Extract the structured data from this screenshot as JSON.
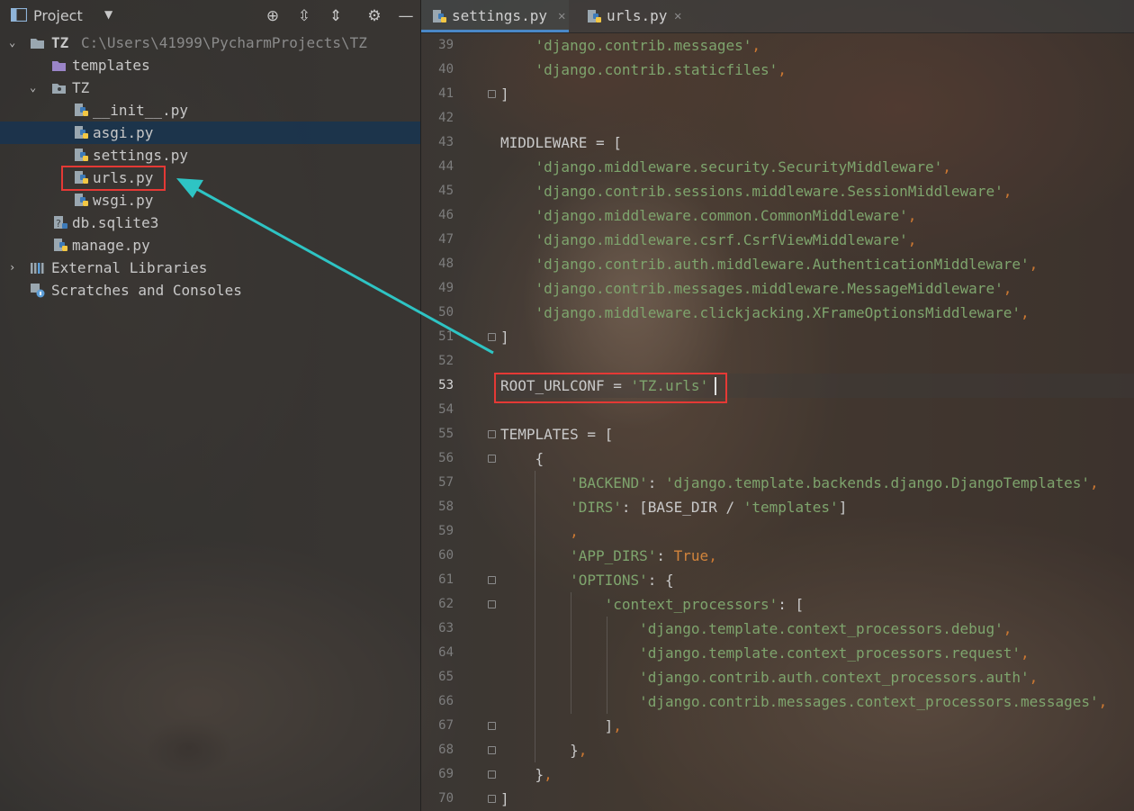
{
  "project_panel": {
    "title": "Project",
    "tree": [
      {
        "label": "TZ",
        "path": "C:\\Users\\41999\\PycharmProjects\\TZ"
      },
      {
        "label": "templates"
      },
      {
        "label": "TZ"
      },
      {
        "label": "__init__.py"
      },
      {
        "label": "asgi.py"
      },
      {
        "label": "settings.py"
      },
      {
        "label": "urls.py"
      },
      {
        "label": "wsgi.py"
      },
      {
        "label": "db.sqlite3"
      },
      {
        "label": "manage.py"
      },
      {
        "label": "External Libraries"
      },
      {
        "label": "Scratches and Consoles"
      }
    ]
  },
  "editor": {
    "tabs": [
      {
        "label": "settings.py",
        "active": true
      },
      {
        "label": "urls.py",
        "active": false
      }
    ],
    "line_numbers": [
      "39",
      "40",
      "41",
      "42",
      "43",
      "44",
      "45",
      "46",
      "47",
      "48",
      "49",
      "50",
      "51",
      "52",
      "53",
      "54",
      "55",
      "56",
      "57",
      "58",
      "59",
      "60",
      "61",
      "62",
      "63",
      "64",
      "65",
      "66",
      "67",
      "68",
      "69",
      "70"
    ],
    "lines": [
      [
        {
          "t": "    "
        },
        {
          "t": "'django.contrib.messages'",
          "c": "s"
        },
        {
          "t": ",",
          "c": "p"
        }
      ],
      [
        {
          "t": "    "
        },
        {
          "t": "'django.contrib.staticfiles'",
          "c": "s"
        },
        {
          "t": ",",
          "c": "p"
        }
      ],
      [
        {
          "t": "]"
        }
      ],
      [
        {
          "t": ""
        }
      ],
      [
        {
          "t": "MIDDLEWARE = ["
        }
      ],
      [
        {
          "t": "    "
        },
        {
          "t": "'django.middleware.security.SecurityMiddleware'",
          "c": "s"
        },
        {
          "t": ",",
          "c": "p"
        }
      ],
      [
        {
          "t": "    "
        },
        {
          "t": "'django.contrib.sessions.middleware.SessionMiddleware'",
          "c": "s"
        },
        {
          "t": ",",
          "c": "p"
        }
      ],
      [
        {
          "t": "    "
        },
        {
          "t": "'django.middleware.common.CommonMiddleware'",
          "c": "s"
        },
        {
          "t": ",",
          "c": "p"
        }
      ],
      [
        {
          "t": "    "
        },
        {
          "t": "'django.middleware.csrf.CsrfViewMiddleware'",
          "c": "s"
        },
        {
          "t": ",",
          "c": "p"
        }
      ],
      [
        {
          "t": "    "
        },
        {
          "t": "'django.contrib.auth.middleware.AuthenticationMiddleware'",
          "c": "s"
        },
        {
          "t": ",",
          "c": "p"
        }
      ],
      [
        {
          "t": "    "
        },
        {
          "t": "'django.contrib.messages.middleware.MessageMiddleware'",
          "c": "s"
        },
        {
          "t": ",",
          "c": "p"
        }
      ],
      [
        {
          "t": "    "
        },
        {
          "t": "'django.middleware.clickjacking.XFrameOptionsMiddleware'",
          "c": "s"
        },
        {
          "t": ",",
          "c": "p"
        }
      ],
      [
        {
          "t": "]"
        }
      ],
      [
        {
          "t": ""
        }
      ],
      [
        {
          "t": "ROOT_URLCONF = "
        },
        {
          "t": "'TZ.urls'",
          "c": "s"
        }
      ],
      [
        {
          "t": ""
        }
      ],
      [
        {
          "t": "TEMPLATES = ["
        }
      ],
      [
        {
          "t": "    {"
        }
      ],
      [
        {
          "t": "        "
        },
        {
          "t": "'BACKEND'",
          "c": "s"
        },
        {
          "t": ": "
        },
        {
          "t": "'django.template.backends.django.DjangoTemplates'",
          "c": "s"
        },
        {
          "t": ",",
          "c": "p"
        }
      ],
      [
        {
          "t": "        "
        },
        {
          "t": "'DIRS'",
          "c": "s"
        },
        {
          "t": ": [BASE_DIR / "
        },
        {
          "t": "'templates'",
          "c": "s"
        },
        {
          "t": "]"
        }
      ],
      [
        {
          "t": "        "
        },
        {
          "t": ",",
          "c": "p"
        }
      ],
      [
        {
          "t": "        "
        },
        {
          "t": "'APP_DIRS'",
          "c": "s"
        },
        {
          "t": ": "
        },
        {
          "t": "True",
          "c": "k"
        },
        {
          "t": ",",
          "c": "p"
        }
      ],
      [
        {
          "t": "        "
        },
        {
          "t": "'OPTIONS'",
          "c": "s"
        },
        {
          "t": ": {"
        }
      ],
      [
        {
          "t": "            "
        },
        {
          "t": "'context_processors'",
          "c": "s"
        },
        {
          "t": ": ["
        }
      ],
      [
        {
          "t": "                "
        },
        {
          "t": "'django.template.context_processors.debug'",
          "c": "s"
        },
        {
          "t": ",",
          "c": "p"
        }
      ],
      [
        {
          "t": "                "
        },
        {
          "t": "'django.template.context_processors.request'",
          "c": "s"
        },
        {
          "t": ",",
          "c": "p"
        }
      ],
      [
        {
          "t": "                "
        },
        {
          "t": "'django.contrib.auth.context_processors.auth'",
          "c": "s"
        },
        {
          "t": ",",
          "c": "p"
        }
      ],
      [
        {
          "t": "                "
        },
        {
          "t": "'django.contrib.messages.context_processors.messages'",
          "c": "s"
        },
        {
          "t": ",",
          "c": "p"
        }
      ],
      [
        {
          "t": "            ]"
        },
        {
          "t": ",",
          "c": "p"
        }
      ],
      [
        {
          "t": "        }"
        },
        {
          "t": ",",
          "c": "p"
        }
      ],
      [
        {
          "t": "    }"
        },
        {
          "t": ",",
          "c": "p"
        }
      ],
      [
        {
          "t": "]"
        }
      ]
    ],
    "current_line": "53"
  },
  "colors": {
    "annotation_box": "#e53935",
    "annotation_arrow": "#2ec4c4",
    "string": "#7ea46d",
    "keyword": "#d2843c",
    "selection": "#183450"
  },
  "icons": [
    "project-window-icon",
    "chevron-down-icon",
    "locate-icon",
    "expand-all-icon",
    "collapse-all-icon",
    "gear-icon",
    "minimize-icon",
    "folder-icon",
    "python-file-icon",
    "database-icon",
    "library-icon",
    "scratches-icon"
  ]
}
